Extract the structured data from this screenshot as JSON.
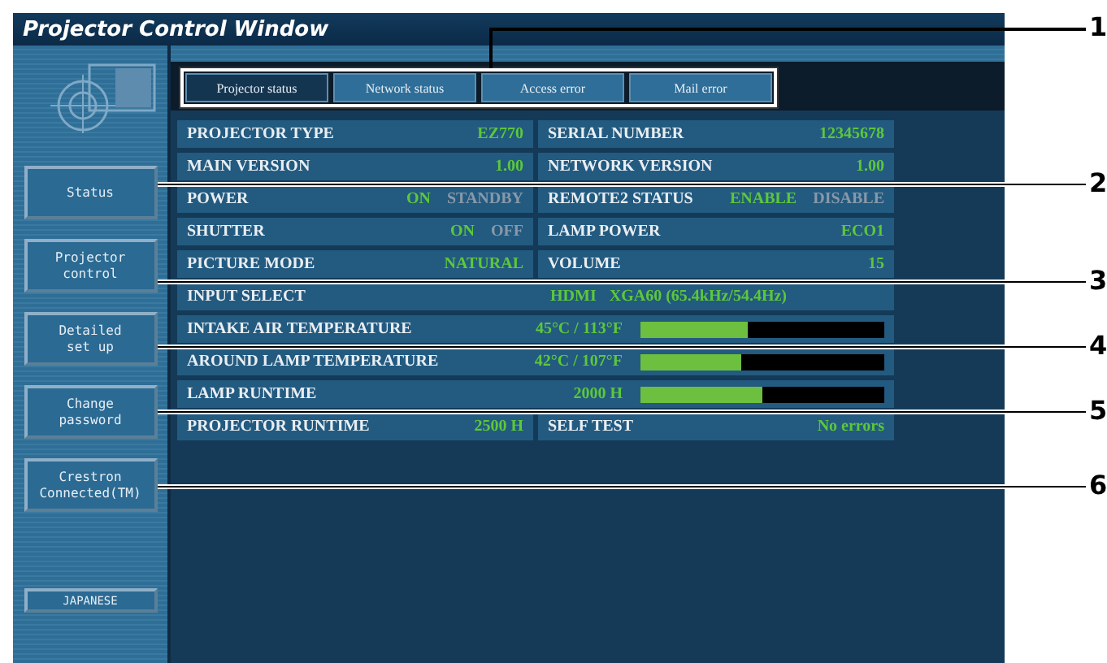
{
  "window": {
    "title": "Projector Control Window"
  },
  "sidebar": {
    "items": [
      {
        "label": "Status"
      },
      {
        "label": "Projector\ncontrol"
      },
      {
        "label": "Detailed\nset up"
      },
      {
        "label": "Change\npassword"
      },
      {
        "label": "Crestron\nConnected(TM)"
      }
    ],
    "language_button": "JAPANESE"
  },
  "tabs": [
    {
      "label": "Projector status",
      "selected": true
    },
    {
      "label": "Network status",
      "selected": false
    },
    {
      "label": "Access error",
      "selected": false
    },
    {
      "label": "Mail error",
      "selected": false
    }
  ],
  "status_rows": [
    {
      "kind": "pair",
      "cells": [
        {
          "label": "PROJECTOR TYPE",
          "value": "EZ770"
        },
        {
          "label": "SERIAL NUMBER",
          "value": "12345678"
        }
      ]
    },
    {
      "kind": "pair",
      "cells": [
        {
          "label": "MAIN VERSION",
          "value": "1.00"
        },
        {
          "label": "NETWORK VERSION",
          "value": "1.00"
        }
      ]
    },
    {
      "kind": "pair",
      "cells": [
        {
          "label": "POWER",
          "options": [
            {
              "label": "ON",
              "selected": true
            },
            {
              "label": "STANDBY",
              "selected": false
            }
          ]
        },
        {
          "label": "REMOTE2 STATUS",
          "options": [
            {
              "label": "ENABLE",
              "selected": true
            },
            {
              "label": "DISABLE",
              "selected": false
            }
          ]
        }
      ]
    },
    {
      "kind": "pair",
      "cells": [
        {
          "label": "SHUTTER",
          "options": [
            {
              "label": "ON",
              "selected": true
            },
            {
              "label": "OFF",
              "selected": false
            }
          ]
        },
        {
          "label": "LAMP POWER",
          "value": "ECO1"
        }
      ]
    },
    {
      "kind": "pair",
      "cells": [
        {
          "label": "PICTURE MODE",
          "value": "NATURAL"
        },
        {
          "label": "VOLUME",
          "value": "15"
        }
      ]
    },
    {
      "kind": "input",
      "label": "INPUT SELECT",
      "value": "HDMI",
      "signal": "XGA60 (65.4kHz/54.4Hz)"
    },
    {
      "kind": "meter",
      "label": "INTAKE AIR TEMPERATURE",
      "value": "45°C / 113°F",
      "level": 0.44
    },
    {
      "kind": "meter",
      "label": "AROUND LAMP TEMPERATURE",
      "value": "42°C / 107°F",
      "level": 0.41
    },
    {
      "kind": "meter",
      "label": "LAMP RUNTIME",
      "value": "2000 H",
      "level": 0.5
    },
    {
      "kind": "pair",
      "cells": [
        {
          "label": "PROJECTOR RUNTIME",
          "value": "2500 H"
        },
        {
          "label": "SELF TEST",
          "value": "No errors"
        }
      ]
    }
  ],
  "callouts": [
    "1",
    "2",
    "3",
    "4",
    "5",
    "6"
  ]
}
